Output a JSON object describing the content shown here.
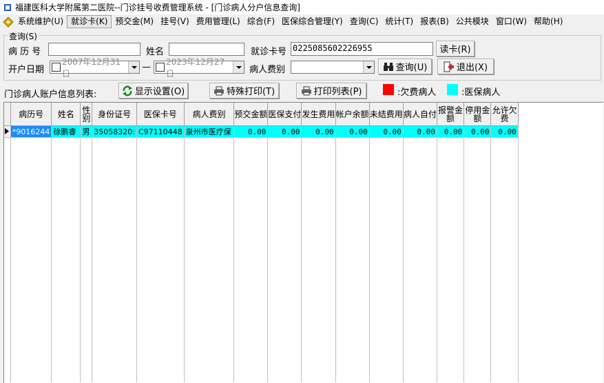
{
  "window": {
    "title": "福建医科大学附属第二医院--门诊挂号收费管理系统 - [门诊病人分户信息查询]"
  },
  "menu": [
    {
      "label": "系统维护(U)"
    },
    {
      "label": "就诊卡(K)",
      "active": true
    },
    {
      "label": "预交金(M)"
    },
    {
      "label": "挂号(V)"
    },
    {
      "label": "费用管理(L)"
    },
    {
      "label": "综合(F)"
    },
    {
      "label": "医保综合管理(Y)"
    },
    {
      "label": "查询(C)"
    },
    {
      "label": "统计(T)"
    },
    {
      "label": "报表(B)"
    },
    {
      "label": "公共模块"
    },
    {
      "label": "窗口(W)"
    },
    {
      "label": "帮助(H)"
    }
  ],
  "query": {
    "group_label": "查询(S)",
    "record_no_label": "病 历 号",
    "record_no_value": "",
    "name_label": "姓名",
    "name_value": "",
    "card_no_label": "就诊卡号",
    "card_no_value": "0225085602226955",
    "read_card_button": "读卡(R)",
    "open_date_label": "开户日期",
    "date_from": "2007年12月31日",
    "date_sep": "—",
    "date_to": "2023年12月27日",
    "fee_type_label": "病人费别",
    "fee_type_value": "",
    "query_button": "查询(U)",
    "exit_button": "退出(X)"
  },
  "toolbar": {
    "list_label": "门诊病人账户信息列表:",
    "display_settings_button": "显示设置(O)",
    "special_print_button": "特殊打印(T)",
    "print_list_button": "打印列表(P)",
    "legend_owing": ":欠费病人",
    "legend_insured": ":医保病人"
  },
  "colors": {
    "owing": "#ff0000",
    "insured": "#00ffff",
    "selected_row": "#00ffff"
  },
  "table": {
    "columns": [
      "病历号",
      "姓名",
      "性别",
      "身份证号",
      "医保卡号",
      "病人费别",
      "预交金额",
      "医保支付",
      "发生费用",
      "帐户余额",
      "未结费用",
      "病人自付",
      "报警金额",
      "停用金额",
      "允许欠费"
    ],
    "rows": [
      [
        "*9016244",
        "徐鹏睿",
        "男",
        "35058320:",
        "C97110448",
        "泉州市医疗保",
        "0.00",
        "0.00",
        "0.00",
        "0.00",
        "0.00",
        "0.00",
        "0.00",
        "0.00",
        "0.00"
      ]
    ]
  }
}
